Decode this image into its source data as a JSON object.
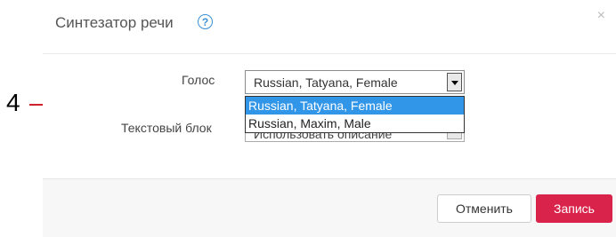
{
  "annotation": {
    "number": "4",
    "arrow_color": "#d0202a"
  },
  "dialog": {
    "title": "Синтезатор речи",
    "help_icon": "question-circle-icon",
    "close_icon": "×"
  },
  "form": {
    "voice_label": "Голос",
    "voice_value": "Russian, Tatyana, Female",
    "voice_options": [
      "Russian, Tatyana, Female",
      "Russian, Maxim, Male"
    ],
    "text_block_label": "Текстовый блок",
    "text_block_value": "Использовать описание"
  },
  "footer": {
    "cancel_label": "Отменить",
    "save_label": "Запись"
  },
  "colors": {
    "accent": "#3b8fd4",
    "selected_option": "#3296e8",
    "primary_button": "#d9234a"
  }
}
